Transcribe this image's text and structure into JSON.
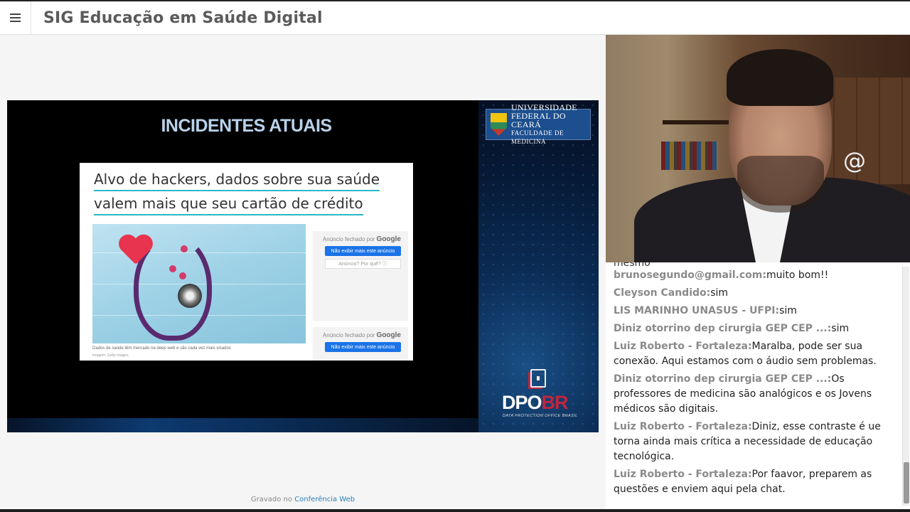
{
  "app": {
    "title": "SIG Educação em Saúde Digital"
  },
  "slide": {
    "title": "INCIDENTES ATUAIS",
    "university": {
      "line1": "UNIVERSIDADE",
      "line2": "FEDERAL DO CEARÁ",
      "line3": "FACULDADE DE MEDICINA"
    },
    "article": {
      "headline_line1": "Alvo de hackers, dados sobre sua saúde",
      "headline_line2": "valem mais que seu cartão de crédito",
      "caption": "Dados de saúde têm mercado na deep web e são cada vez mais visados",
      "credit": "Imagem: Getty Images"
    },
    "ads": {
      "closed_by": "Anúncio fechado por",
      "google": "Google",
      "hide_button": "Não exibir mais este anúncio",
      "why_button": "Anúncio? Por quê? ⓘ"
    },
    "brand": {
      "dpo": "DPO",
      "br": "BR",
      "subtitle": "DATA PROTECTION OFFICE BRASIL"
    }
  },
  "footer": {
    "recorded_prefix": "Gravado no",
    "recorded_link": "Conferência Web"
  },
  "chat": {
    "cut_text": "mesmo",
    "messages": [
      {
        "author": "brunosegundo@gmail.com:",
        "text": "muito bom!!"
      },
      {
        "author": "Cleyson Candido:",
        "text": "sim"
      },
      {
        "author": "LIS MARINHO UNASUS - UFPI:",
        "text": "sim"
      },
      {
        "author": "Diniz otorrino dep cirurgia GEP CEP ...:",
        "text": "sim"
      },
      {
        "author": "Luiz Roberto - Fortaleza:",
        "text": "Maralba, pode ser sua conexão. Aqui estamos com o áudio sem problemas."
      },
      {
        "author": "Diniz otorrino dep cirurgia GEP CEP ...:",
        "text": "Os professores de medicina são analógicos e os Jovens médicos são digitais."
      },
      {
        "author": "Luiz Roberto - Fortaleza:",
        "text": "Diniz, esse contraste é ue torna ainda mais crítica a necessidade de educação tecnológica."
      },
      {
        "author": "Luiz Roberto - Fortaleza:",
        "text": "Por faavor, preparem as questões e enviem aqui pela chat."
      }
    ]
  },
  "icons": {
    "menu": "hamburger-menu-icon",
    "dpo": "document-lock-icon",
    "crest": "university-crest-icon"
  },
  "colors": {
    "title_text": "#5a5a5a",
    "slide_title": "#b9d2ea",
    "headline_underline": "#2ab7c9",
    "dpo_accent": "#c0263e",
    "ufc_blue": "#1d4f8f",
    "link": "#2a7fb8"
  }
}
